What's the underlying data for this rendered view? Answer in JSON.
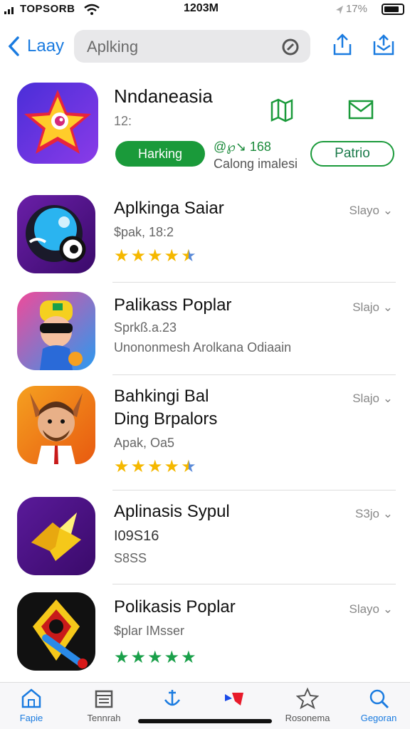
{
  "status": {
    "carrier": "TOPSORB",
    "time": "1203M",
    "battery": "17%"
  },
  "nav": {
    "back_label": "Laay",
    "search_placeholder": "Aplking"
  },
  "hero": {
    "name": "Nndaneasia",
    "subtitle": "12:",
    "get_label": "Harking",
    "meta_line1": "@℘↘ 168",
    "meta_line2": "Calong imalesi",
    "open_label": "Patrio"
  },
  "apps": [
    {
      "title_lines": [
        "Aplkinga Saiar"
      ],
      "line1": "$pak, 18:2",
      "line2": "",
      "rating": 4.5,
      "size": "Slayo",
      "star_color": "#f5b800"
    },
    {
      "title_lines": [
        "Palikass Poplar"
      ],
      "line1": "Sprkß.a.23",
      "line2": "Unononmesh Arolkana Odiaain",
      "rating": 0,
      "size": "Slajo",
      "star_color": "#f5b800"
    },
    {
      "title_lines": [
        "Bahkingi Bal",
        "Ding Brpalors"
      ],
      "line1": "Apak, Oa5",
      "line2": "",
      "rating": 4.5,
      "size": "Slajo",
      "star_color": "#f5b800"
    },
    {
      "title_lines": [
        "Aplinasis Sypul"
      ],
      "line1": "I09S16",
      "line2": "S8SS",
      "rating": 0,
      "size": "S3jo",
      "star_color": "#f5b800"
    },
    {
      "title_lines": [
        "Polikasis Poplar"
      ],
      "line1": "$plar IMsser",
      "line2": "",
      "rating": 5,
      "size": "Slayo",
      "star_color": "#1aa04a"
    }
  ],
  "tabs": [
    {
      "label": "Fapie",
      "icon": "home-icon",
      "active": true
    },
    {
      "label": "Tennrah",
      "icon": "calendar-icon",
      "active": false
    },
    {
      "label": "",
      "icon": "anchor-icon",
      "active": false
    },
    {
      "label": "",
      "icon": "game-icon",
      "active": false
    },
    {
      "label": "Rosonema",
      "icon": "star-icon",
      "active": false
    },
    {
      "label": "Gegoran",
      "icon": "search-icon",
      "active": true
    }
  ],
  "colors": {
    "accent": "#1a7be0",
    "green": "#1a9a3a"
  }
}
